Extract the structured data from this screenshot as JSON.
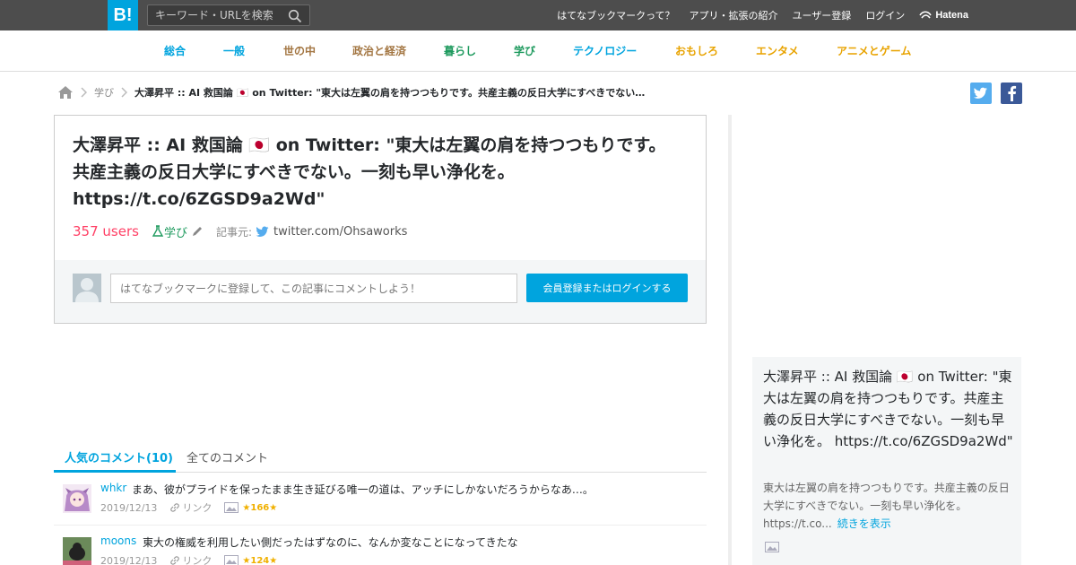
{
  "header": {
    "logo": "B!",
    "search_placeholder": "キーワード・URLを検索",
    "nav": [
      "はてなブックマークって？",
      "アプリ・拡張の紹介",
      "ユーザー登録",
      "ログイン"
    ],
    "brand": "Hatena"
  },
  "categories": [
    {
      "label": "総合",
      "color": "#00a4de"
    },
    {
      "label": "一般",
      "color": "#00a4de"
    },
    {
      "label": "世の中",
      "color": "#a37642"
    },
    {
      "label": "政治と経済",
      "color": "#a37642"
    },
    {
      "label": "暮らし",
      "color": "#1e9a5e"
    },
    {
      "label": "学び",
      "color": "#1e9a5e"
    },
    {
      "label": "テクノロジー",
      "color": "#00a4de"
    },
    {
      "label": "おもしろ",
      "color": "#e8a300"
    },
    {
      "label": "エンタメ",
      "color": "#e8a300"
    },
    {
      "label": "アニメとゲーム",
      "color": "#e8a300"
    }
  ],
  "breadcrumb": {
    "category": "学び",
    "current": "大澤昇平 :: AI 救国論 🇯🇵 on Twitter: \"東大は左翼の肩を持つつもりです。共産主義の反日大学にすべきでない…"
  },
  "entry": {
    "title": "大澤昇平 :: AI 救国論 🇯🇵 on Twitter: \"東大は左翼の肩を持つつもりです。共産主義の反日大学にすべきでない。一刻も早い浄化を。 https://t.co/6ZGSD9a2Wd\"",
    "users": "357 users",
    "category": "学び",
    "source_label": "記事元:",
    "source": "twitter.com/Ohsaworks",
    "comment_placeholder": "はてなブックマークに登録して、この記事にコメントしよう！",
    "login_button": "会員登録またはログインする"
  },
  "tabs": {
    "popular": "人気のコメント(10)",
    "all": "全てのコメント"
  },
  "comments": [
    {
      "user": "whkr",
      "text": "まあ、彼がプライドを保ったまま生き延びる唯一の道は、アッチにしかないだろうからなあ…。",
      "date": "2019/12/13",
      "link": "リンク",
      "stars": "166"
    },
    {
      "user": "moons",
      "text": "東大の権威を利用したい側だったはずなのに、なんか変なことになってきたな",
      "date": "2019/12/13",
      "link": "リンク",
      "stars": "124"
    }
  ],
  "sidebar": {
    "title": "大澤昇平 :: AI 救国論 🇯🇵 on Twitter: \"東大は左翼の肩を持つつもりです。共産主義の反日大学にすべきでない。一刻も早い浄化を。 https://t.co/6ZGSD9a2Wd\"",
    "desc": "東大は左翼の肩を持つつもりです。共産主義の反日大学にすべきでない。一刻も早い浄化を。 https://t.co...",
    "more": "続きを表示"
  },
  "colors": {
    "accent": "#00a4de",
    "topbar": "#4d4d4d",
    "users": "#ff4166",
    "twitter": "#55acee",
    "facebook": "#3b5998"
  }
}
